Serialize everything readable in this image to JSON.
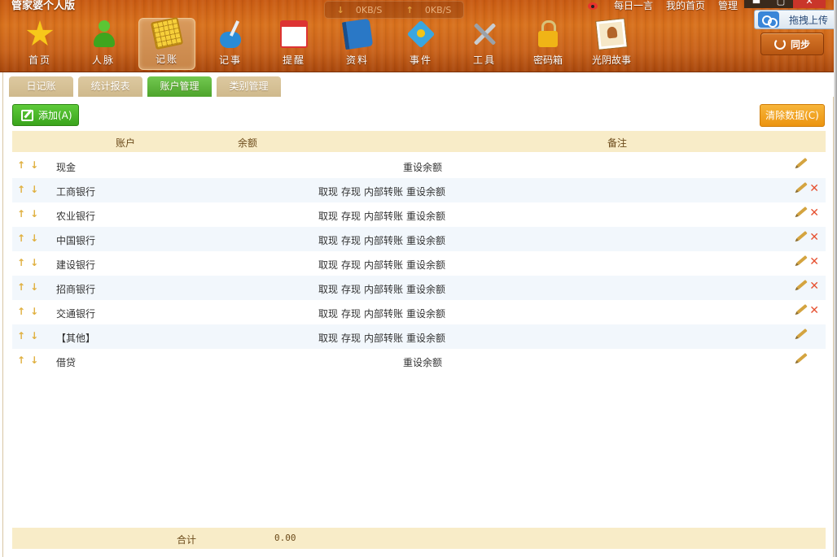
{
  "app": {
    "title": "管家婆个人版",
    "speed_down": "0KB/S",
    "speed_up": "0KB/S",
    "links": [
      "每日一言",
      "我的首页",
      "管理"
    ],
    "upload_label": "拖拽上传",
    "sync_label": "同步"
  },
  "nav": [
    {
      "label": "首页",
      "icon": "star-icon"
    },
    {
      "label": "人脉",
      "icon": "contacts-icon"
    },
    {
      "label": "记账",
      "icon": "ledger-icon",
      "active": true
    },
    {
      "label": "记事",
      "icon": "ink-pen-icon"
    },
    {
      "label": "提醒",
      "icon": "calendar-icon"
    },
    {
      "label": "资料",
      "icon": "book-icon"
    },
    {
      "label": "事件",
      "icon": "event-icon"
    },
    {
      "label": "工具",
      "icon": "tools-icon"
    },
    {
      "label": "密码箱",
      "icon": "lock-icon"
    },
    {
      "label": "光阴故事",
      "icon": "photo-icon"
    }
  ],
  "subtabs": [
    {
      "label": "日记账"
    },
    {
      "label": "统计报表"
    },
    {
      "label": "账户管理",
      "active": true
    },
    {
      "label": "类别管理"
    }
  ],
  "toolbar": {
    "add_label": "添加(A)",
    "clear_label": "清除数据(C)"
  },
  "table": {
    "headers": {
      "account": "账户",
      "balance": "余额",
      "note": "备注"
    },
    "rows": [
      {
        "name": "现金",
        "actions": [
          "重设余额"
        ],
        "deletable": false
      },
      {
        "name": "工商银行",
        "actions": [
          "取现",
          "存现",
          "内部转账",
          "重设余额"
        ],
        "deletable": true
      },
      {
        "name": "农业银行",
        "actions": [
          "取现",
          "存现",
          "内部转账",
          "重设余额"
        ],
        "deletable": true
      },
      {
        "name": "中国银行",
        "actions": [
          "取现",
          "存现",
          "内部转账",
          "重设余额"
        ],
        "deletable": true
      },
      {
        "name": "建设银行",
        "actions": [
          "取现",
          "存现",
          "内部转账",
          "重设余额"
        ],
        "deletable": true
      },
      {
        "name": "招商银行",
        "actions": [
          "取现",
          "存现",
          "内部转账",
          "重设余额"
        ],
        "deletable": true
      },
      {
        "name": "交通银行",
        "actions": [
          "取现",
          "存现",
          "内部转账",
          "重设余额"
        ],
        "deletable": true
      },
      {
        "name": "【其他】",
        "actions": [
          "取现",
          "存现",
          "内部转账",
          "重设余额"
        ],
        "deletable": false
      },
      {
        "name": "借贷",
        "actions": [
          "重设余额"
        ],
        "deletable": false
      }
    ],
    "footer": {
      "total_label": "合计",
      "total_value": "0.00"
    }
  }
}
